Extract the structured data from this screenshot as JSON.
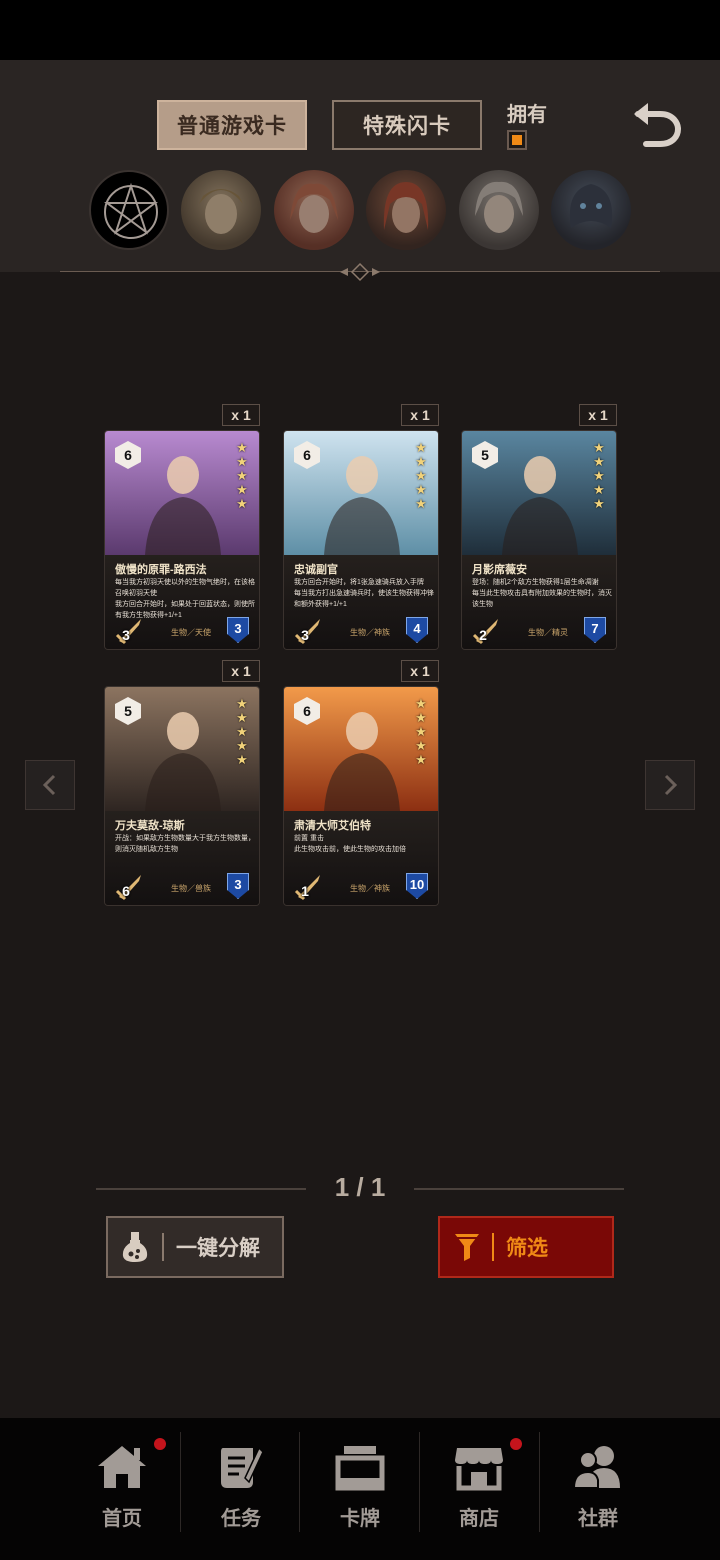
{
  "header": {
    "tab_normal": "普通游戏卡",
    "tab_special": "特殊闪卡",
    "owned_label": "拥有",
    "owned_checked": true
  },
  "cards": [
    {
      "count": "x 1",
      "cost": "6",
      "stars": 5,
      "name": "傲慢的原罪-路西法",
      "desc": [
        "每当我方初羽天使以外的生物气绝时，在该格召唤初羽天使",
        "我方回合开始时，如果处于回蓝状态，则使所有我方生物获得+1/+1"
      ],
      "attack": "3",
      "type": "生物／天使",
      "health": "3",
      "art_colors": [
        "#b88ad0",
        "#5b3a6e"
      ]
    },
    {
      "count": "x 1",
      "cost": "6",
      "stars": 5,
      "name": "忠诚副官",
      "desc": [
        "我方回合开始时，将1张急速骑兵放入手牌",
        "每当我方打出急速骑兵时，使该生物获得冲锋和额外获得+1/+1"
      ],
      "attack": "3",
      "type": "生物／神族",
      "health": "4",
      "art_colors": [
        "#cfe3ef",
        "#5e8fa6"
      ]
    },
    {
      "count": "x 1",
      "cost": "5",
      "stars": 5,
      "name": "月影席薇安",
      "desc": [
        "登场：随机2个敌方生物获得1层生命凋谢",
        "每当此生物攻击具有附加效果的生物时，消灭该生物"
      ],
      "attack": "2",
      "type": "生物／精灵",
      "health": "7",
      "art_colors": [
        "#5a86a0",
        "#1f2e3a"
      ]
    },
    {
      "count": "x 1",
      "cost": "5",
      "stars": 5,
      "name": "万夫莫敌-琼斯",
      "desc": [
        "开战：如果敌方生物数量大于我方生物数量，则消灭随机敌方生物"
      ],
      "attack": "6",
      "type": "生物／兽族",
      "health": "3",
      "art_colors": [
        "#8c7460",
        "#2e2521"
      ]
    },
    {
      "count": "x 1",
      "cost": "6",
      "stars": 5,
      "name": "肃清大师艾伯特",
      "desc": [
        "前置 重击",
        "此生物攻击前，使此生物的攻击加倍"
      ],
      "attack": "1",
      "type": "生物／神族",
      "health": "10",
      "art_colors": [
        "#f29a4a",
        "#8c2f12"
      ]
    }
  ],
  "pager": "1 / 1",
  "buttons": {
    "decompose": "一键分解",
    "filter": "筛选"
  },
  "nav": [
    {
      "label": "首页",
      "icon": "home-icon",
      "has_dot": true
    },
    {
      "label": "任务",
      "icon": "quest-scroll-icon",
      "has_dot": false
    },
    {
      "label": "卡牌",
      "icon": "cards-icon",
      "has_dot": false
    },
    {
      "label": "商店",
      "icon": "shop-icon",
      "has_dot": true
    },
    {
      "label": "社群",
      "icon": "community-icon",
      "has_dot": false
    }
  ],
  "colors": {
    "accent_orange": "#f08a16",
    "filter_red": "#7a0806",
    "badge_red": "#c4141c",
    "health_blue": "#1d4aa3"
  }
}
